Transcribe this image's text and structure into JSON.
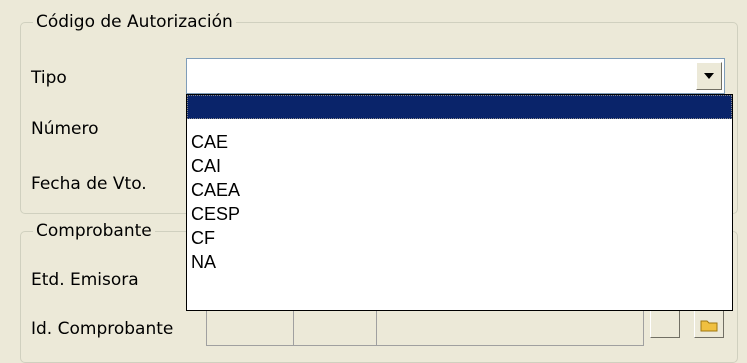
{
  "autorizacion": {
    "title": "Código de Autorización",
    "tipo_label": "Tipo",
    "tipo_value": "",
    "numero_label": "Número",
    "fecha_label": "Fecha de Vto."
  },
  "tipo_dropdown": {
    "options": [
      "",
      "CAE",
      "CAI",
      "CAEA",
      "CESP",
      "CF",
      "NA"
    ],
    "selected_index": 0
  },
  "comprobante": {
    "title": "Comprobante",
    "etd_label": "Etd. Emisora",
    "id_label": "Id. Comprobante"
  },
  "colors": {
    "window_bg": "#ECE9D8",
    "selection": "#0A246A",
    "folder_icon": "#F0C040"
  },
  "icons": [
    "chevron-down-icon",
    "folder-icon"
  ]
}
